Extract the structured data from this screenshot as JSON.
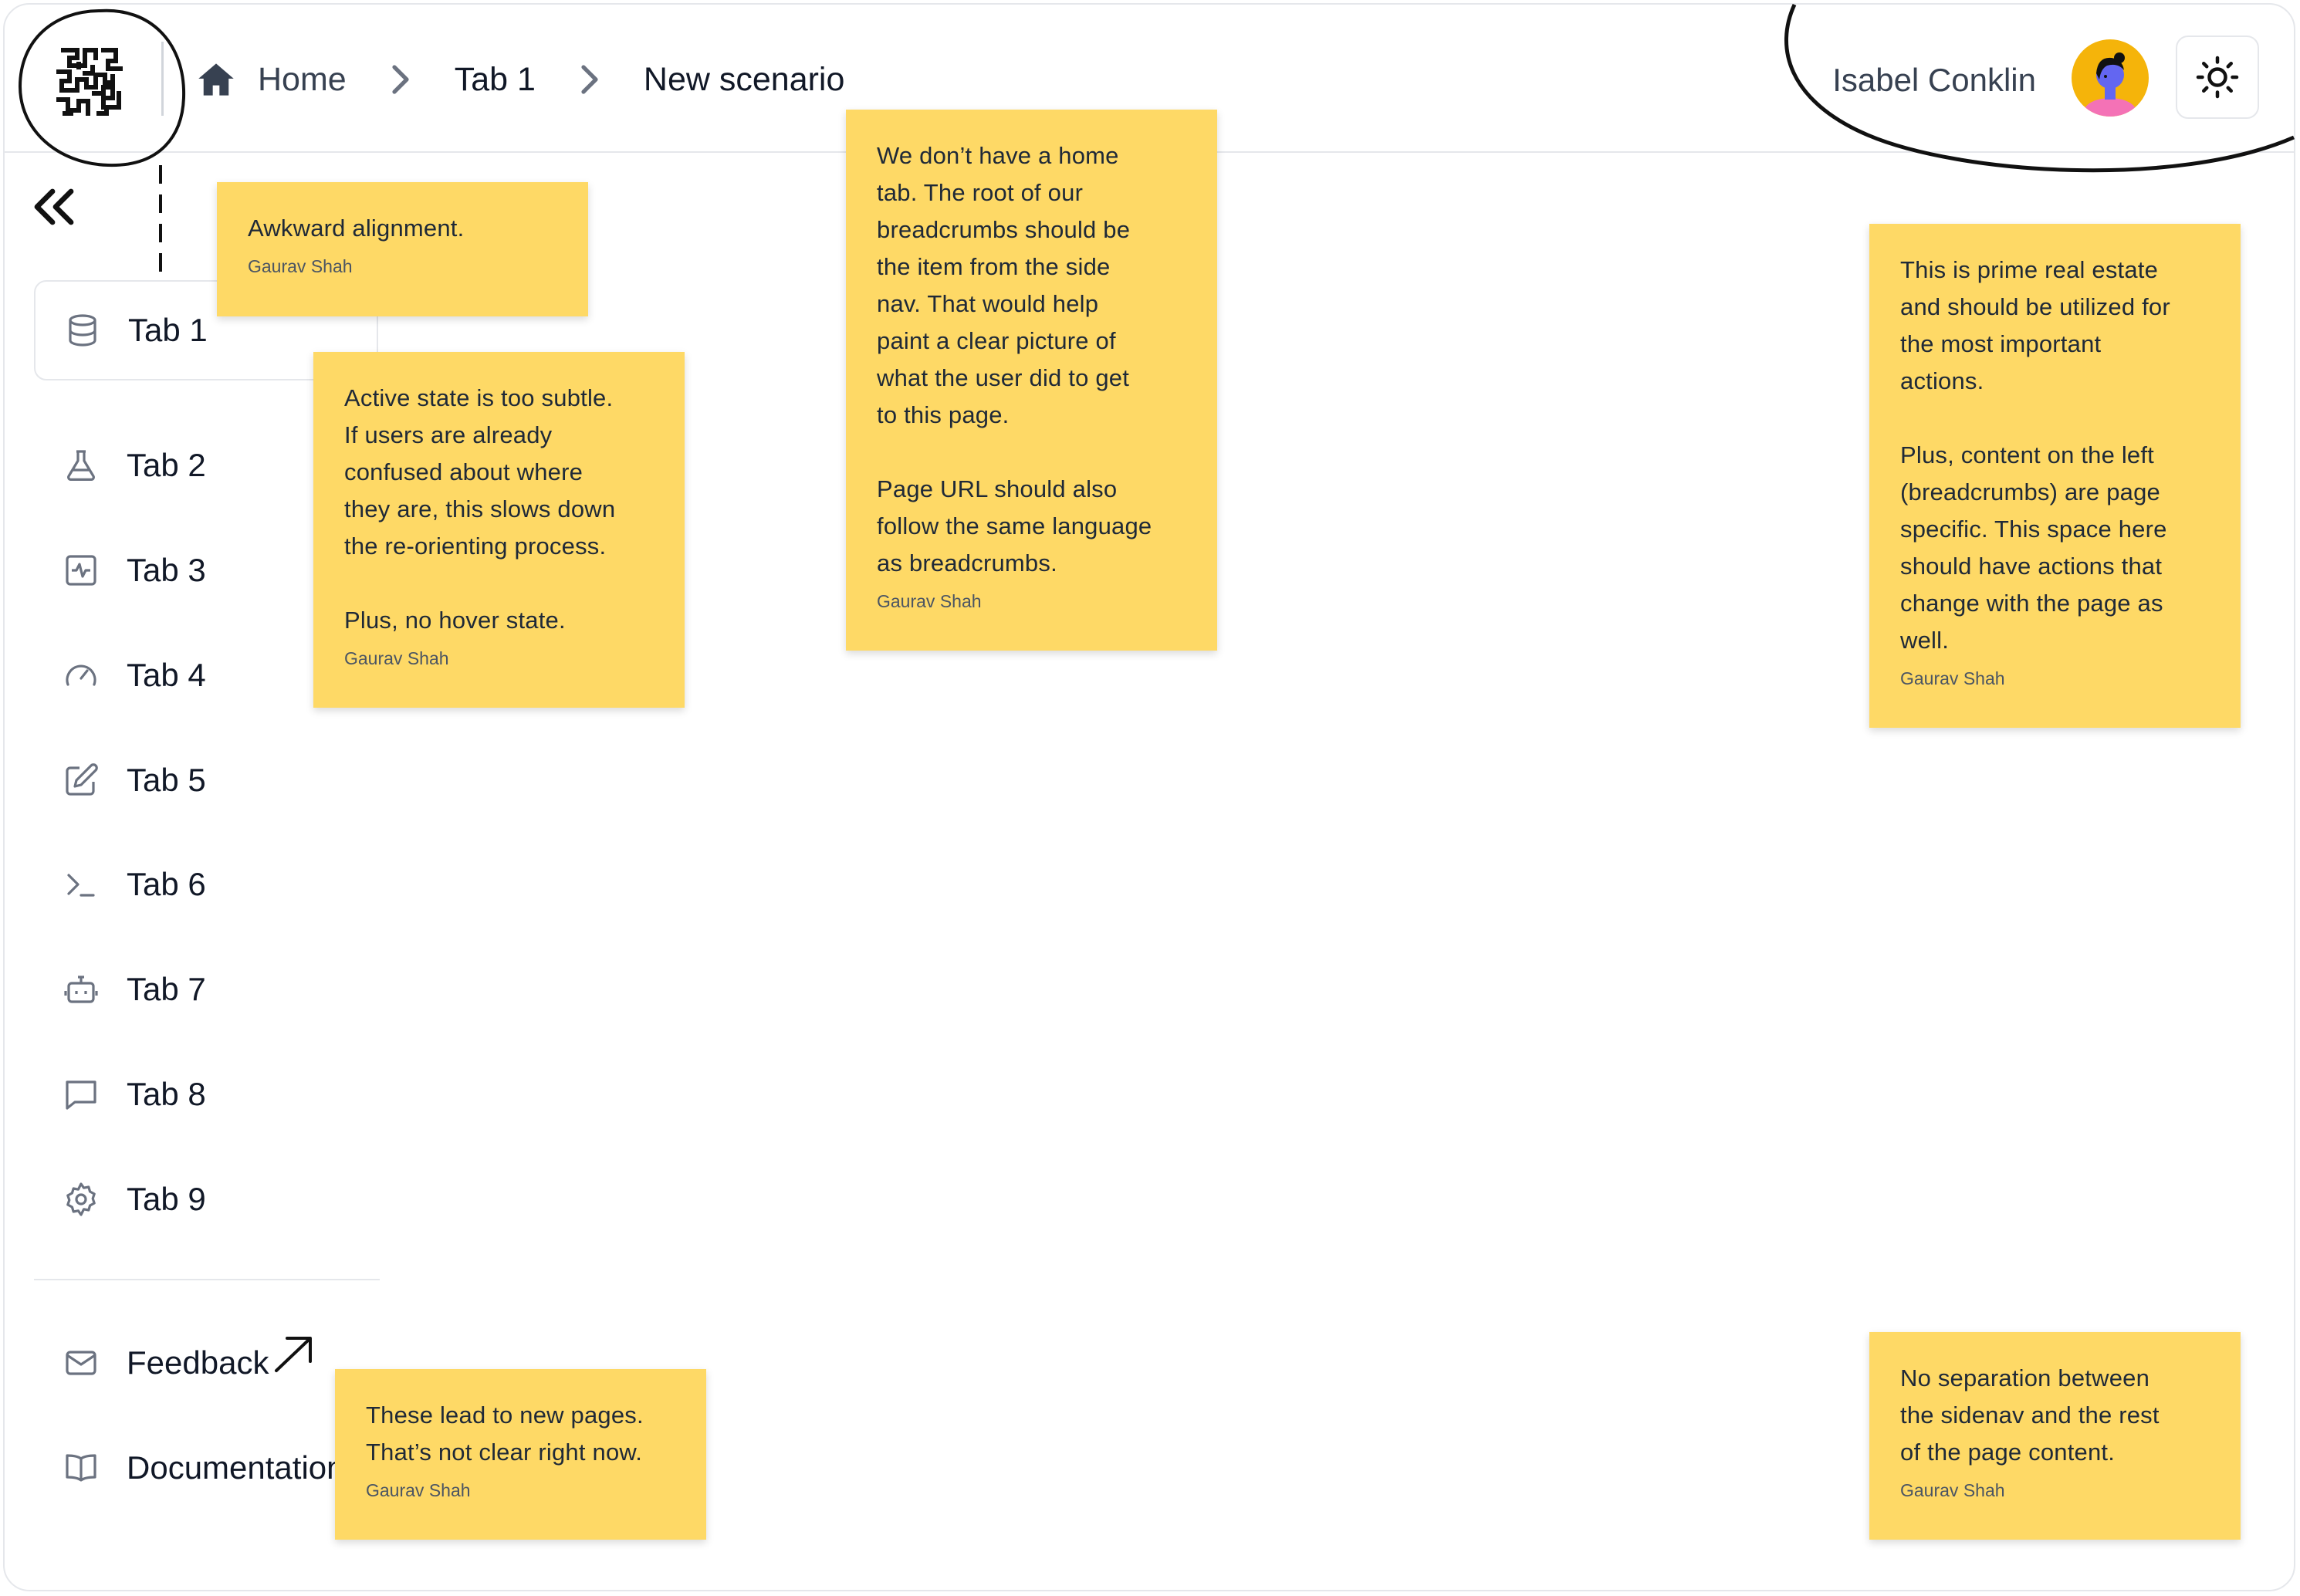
{
  "header": {
    "breadcrumbs": [
      "Home",
      "Tab 1",
      "New scenario"
    ],
    "user_name": "Isabel Conklin"
  },
  "sidebar": {
    "items": [
      {
        "label": "Tab 1",
        "icon": "database-icon",
        "active": true
      },
      {
        "label": "Tab 2",
        "icon": "flask-icon"
      },
      {
        "label": "Tab 3",
        "icon": "activity-icon"
      },
      {
        "label": "Tab 4",
        "icon": "gauge-icon"
      },
      {
        "label": "Tab 5",
        "icon": "edit-icon"
      },
      {
        "label": "Tab 6",
        "icon": "terminal-icon"
      },
      {
        "label": "Tab 7",
        "icon": "bot-icon"
      },
      {
        "label": "Tab 8",
        "icon": "chat-icon"
      },
      {
        "label": "Tab 9",
        "icon": "gear-icon"
      }
    ],
    "footer_items": [
      {
        "label": "Feedback",
        "icon": "mail-icon"
      },
      {
        "label": "Documentation",
        "icon": "book-icon"
      }
    ]
  },
  "notes": [
    {
      "text": "Awkward alignment.",
      "author": "Gaurav Shah"
    },
    {
      "text": "Active state is too subtle.\nIf users are already\nconfused about where\nthey are, this slows down\nthe re-orienting process.\n\nPlus, no hover state.",
      "author": "Gaurav Shah"
    },
    {
      "text": "We don’t have a home\ntab. The root of our\nbreadcrumbs should be\nthe item from the side\nnav. That would help\npaint a clear picture of\nwhat the user did to get\nto this page.\n\nPage URL should also\nfollow the same language\nas breadcrumbs.",
      "author": "Gaurav Shah"
    },
    {
      "text": "This is prime real estate\nand should be utilized for\nthe most important\nactions.\n\nPlus, content on the left\n(breadcrumbs) are page\nspecific. This space here\nshould have actions that\nchange with the page as\nwell.",
      "author": "Gaurav Shah"
    },
    {
      "text": "These lead to new pages.\nThat’s not clear right now.",
      "author": "Gaurav Shah"
    },
    {
      "text": "No separation between\nthe sidenav and the rest\nof the page content.",
      "author": "Gaurav Shah"
    }
  ],
  "colors": {
    "note_bg": "#fed966",
    "avatar_bg": "#f5b40a",
    "border": "#e5e7eb"
  }
}
